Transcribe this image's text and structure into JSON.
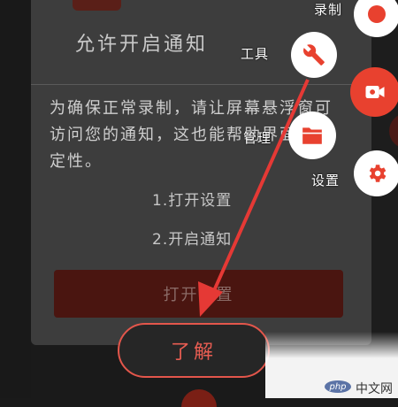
{
  "dialog": {
    "title": "允许开启通知",
    "body": "为确保正常录制，请让屏幕悬浮窗可访问您的通知，这也能帮助界面更稳定性。",
    "step1": "1.打开设置",
    "step2": "2.开启通知",
    "open_settings_label": "打开设置",
    "got_it_label": "了解"
  },
  "floating_menu": {
    "record_label": "录制",
    "tools_label": "工具",
    "manage_label": "管理",
    "settings_label": "设置"
  },
  "colors": {
    "accent": "#e8412f",
    "arrow": "#e53935"
  },
  "icons": [
    "record-dot-icon",
    "wrench-icon",
    "video-camera-icon",
    "folder-icon",
    "gear-icon"
  ],
  "watermark": {
    "logo": "php",
    "text": "中文网"
  }
}
